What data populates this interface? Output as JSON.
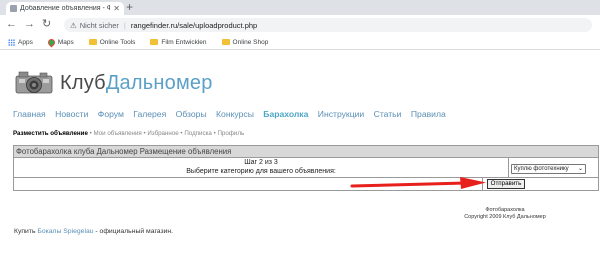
{
  "browser": {
    "tab_title": "Добавление объявления - Фото",
    "url_warning": "Nicht sicher",
    "url": "rangefinder.ru/sale/uploadproduct.php",
    "bookmarks": [
      "Apps",
      "Maps",
      "Online Tools",
      "Film Entwicklen",
      "Online Shop"
    ]
  },
  "site": {
    "brand_part1": "Клуб",
    "brand_part2": "Дальномер",
    "nav": [
      "Главная",
      "Новости",
      "Форум",
      "Галерея",
      "Обзоры",
      "Конкурсы",
      "Барахолка",
      "Инструкции",
      "Статьи",
      "Правила"
    ],
    "active_nav": "Барахолка",
    "subnav": {
      "current": "Разместить объявление",
      "rest": " • Мои объявления • Избранное • Подписка • Профиль"
    }
  },
  "form": {
    "header": "Фотобарахолка клуба Дальномер Размещение объявления",
    "step": "Шаг 2 из 3",
    "prompt": "Выберите категорию для вашего объявления:",
    "selected_category": "Куплю фототехнику",
    "submit_label": "Отправить"
  },
  "footer": {
    "line1": "Фотобарахолка",
    "line2": "Copyright 2009 Клуб Дальномер"
  },
  "promo": {
    "prefix": "Купить ",
    "link": "Бокалы Spiegelau",
    "suffix": " - официальный магазин."
  },
  "colors": {
    "accent": "#4ea6c6",
    "link": "#5b8fb6",
    "arrow": "#e8201c"
  }
}
